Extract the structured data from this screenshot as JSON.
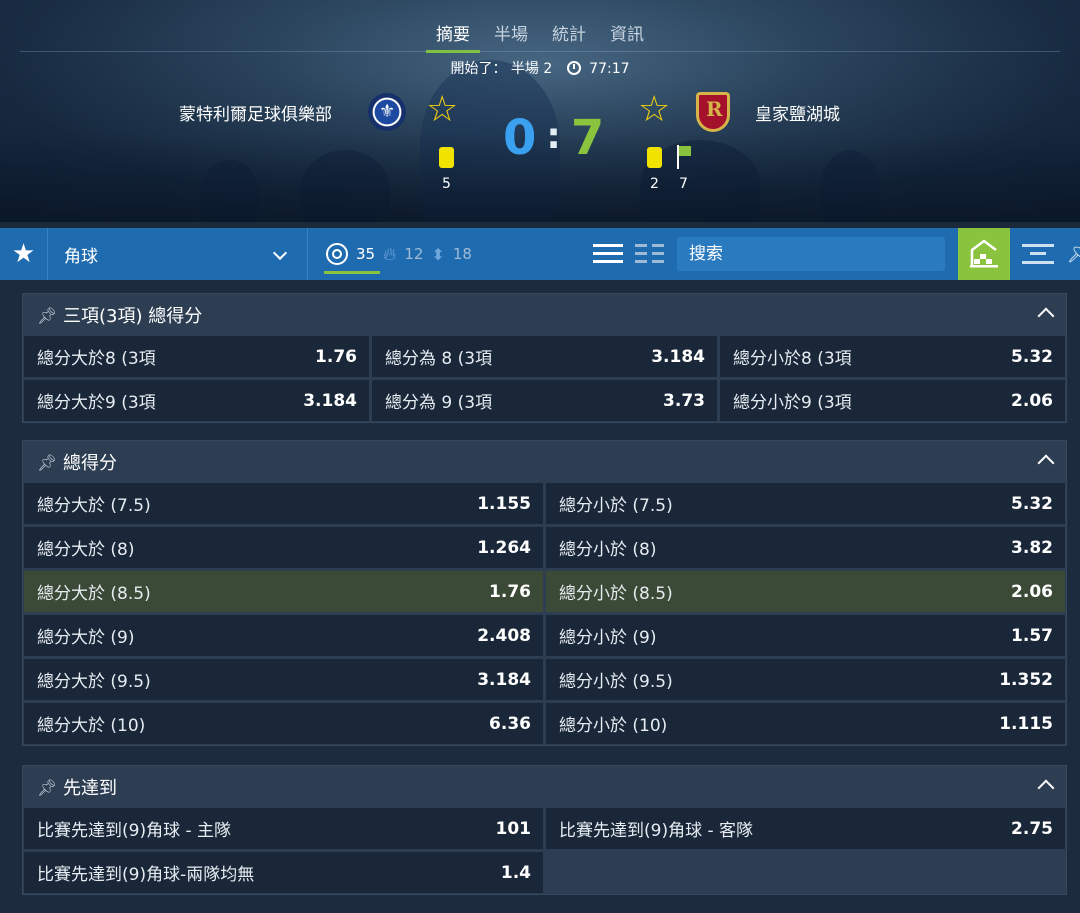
{
  "header": {
    "tabs": [
      "摘要",
      "半場",
      "統計",
      "資訊"
    ],
    "status_prefix": "開始了：",
    "period": "半場 2",
    "time": "77:17",
    "home": {
      "name": "蒙特利爾足球俱樂部",
      "yellow_cards": "5"
    },
    "away": {
      "name": "皇家鹽湖城",
      "yellow_cards": "2",
      "corners": "7"
    },
    "score_home": "0",
    "score_sep": ":",
    "score_away": "7"
  },
  "toolbar": {
    "market_select": "角球",
    "count_all": "35",
    "count_hot": "12",
    "count_move": "18",
    "search_placeholder": "搜索"
  },
  "markets": [
    {
      "title": "三項(3項) 總得分",
      "rows": [
        [
          {
            "label": "總分大於8 (3項",
            "odds": "1.76"
          },
          {
            "label": "總分為 8 (3項",
            "odds": "3.184"
          },
          {
            "label": "總分小於8 (3項",
            "odds": "5.32"
          }
        ],
        [
          {
            "label": "總分大於9 (3項",
            "odds": "3.184"
          },
          {
            "label": "總分為 9 (3項",
            "odds": "3.73"
          },
          {
            "label": "總分小於9 (3項",
            "odds": "2.06"
          }
        ]
      ]
    },
    {
      "title": "總得分",
      "rows": [
        [
          {
            "label": "總分大於 (7.5)",
            "odds": "1.155"
          },
          {
            "label": "總分小於 (7.5)",
            "odds": "5.32"
          }
        ],
        [
          {
            "label": "總分大於 (8)",
            "odds": "1.264"
          },
          {
            "label": "總分小於 (8)",
            "odds": "3.82"
          }
        ],
        [
          {
            "label": "總分大於 (8.5)",
            "odds": "1.76"
          },
          {
            "label": "總分小於 (8.5)",
            "odds": "2.06"
          }
        ],
        [
          {
            "label": "總分大於 (9)",
            "odds": "2.408"
          },
          {
            "label": "總分小於 (9)",
            "odds": "1.57"
          }
        ],
        [
          {
            "label": "總分大於 (9.5)",
            "odds": "3.184"
          },
          {
            "label": "總分小於 (9.5)",
            "odds": "1.352"
          }
        ],
        [
          {
            "label": "總分大於 (10)",
            "odds": "6.36"
          },
          {
            "label": "總分小於 (10)",
            "odds": "1.115"
          }
        ]
      ]
    },
    {
      "title": "先達到",
      "rows": [
        [
          {
            "label": "比賽先達到(9)角球 - 主隊",
            "odds": "101"
          },
          {
            "label": "比賽先達到(9)角球 - 客隊",
            "odds": "2.75"
          }
        ],
        [
          {
            "label": "比賽先達到(9)角球-兩隊均無",
            "odds": "1.4"
          }
        ]
      ]
    }
  ],
  "colors": {
    "accent": "#8ac43e",
    "toolbar": "#1f6bb0",
    "home_score": "#3aa0f0",
    "yellow_card": "#f2e200",
    "highlight_cell": "#3b4a36"
  },
  "icons": [
    "star-icon",
    "chevron-down-icon",
    "target-icon",
    "fire-icon",
    "updown-arrows-icon",
    "list-view-icon",
    "grid-view-icon",
    "live-stadium-icon",
    "collapse-top-icon",
    "pin-icon",
    "caret-up-icon",
    "clock-icon",
    "yellow-card-icon",
    "corner-flag-icon"
  ]
}
